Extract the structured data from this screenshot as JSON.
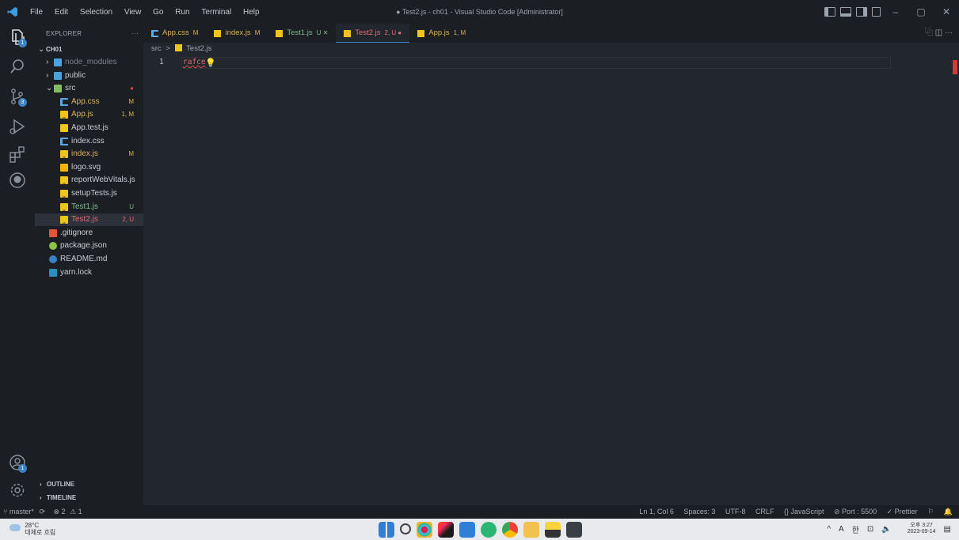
{
  "titlebar": {
    "menu": [
      "File",
      "Edit",
      "Selection",
      "View",
      "Go",
      "Run",
      "Terminal",
      "Help"
    ],
    "window_title": "● Test2.js - ch01 - Visual Studio Code [Administrator]",
    "minimize": "–",
    "restore": "▢",
    "close": "✕"
  },
  "activity": {
    "explorer_badge": "1",
    "scm_badge": "3",
    "accounts_badge": "1"
  },
  "sidebar": {
    "header": "EXPLORER",
    "more": "···",
    "root": "CH01",
    "items": [
      {
        "name": "node_modules",
        "twistie": "›",
        "indent": 1,
        "type": "folder",
        "status": ""
      },
      {
        "name": "public",
        "twistie": "›",
        "indent": 1,
        "type": "folder",
        "status": ""
      },
      {
        "name": "src",
        "twistie": "⌄",
        "indent": 1,
        "type": "folder-open",
        "status": "●"
      },
      {
        "name": "App.css",
        "indent": 2,
        "type": "css",
        "status": "M"
      },
      {
        "name": "App.js",
        "indent": 2,
        "type": "js",
        "status": "1, M"
      },
      {
        "name": "App.test.js",
        "indent": 2,
        "type": "test",
        "status": ""
      },
      {
        "name": "index.css",
        "indent": 2,
        "type": "css",
        "status": ""
      },
      {
        "name": "index.js",
        "indent": 2,
        "type": "js",
        "status": "M"
      },
      {
        "name": "logo.svg",
        "indent": 2,
        "type": "svg",
        "status": ""
      },
      {
        "name": "reportWebVitals.js",
        "indent": 2,
        "type": "js",
        "status": ""
      },
      {
        "name": "setupTests.js",
        "indent": 2,
        "type": "js",
        "status": ""
      },
      {
        "name": "Test1.js",
        "indent": 2,
        "type": "js",
        "status": "U"
      },
      {
        "name": "Test2.js",
        "indent": 2,
        "type": "js",
        "status": "2, U"
      },
      {
        "name": ".gitignore",
        "indent": 1,
        "type": "git",
        "status": ""
      },
      {
        "name": "package.json",
        "indent": 1,
        "type": "json",
        "status": ""
      },
      {
        "name": "README.md",
        "indent": 1,
        "type": "info",
        "status": ""
      },
      {
        "name": "yarn.lock",
        "indent": 1,
        "type": "yarn",
        "status": ""
      }
    ],
    "outline": "OUTLINE",
    "timeline": "TIMELINE"
  },
  "tabs": [
    {
      "name": "App.css",
      "mark": "M",
      "icon": "css"
    },
    {
      "name": "index.js",
      "mark": "M",
      "icon": "js"
    },
    {
      "name": "Test1.js",
      "mark": "U ✕",
      "icon": "js"
    },
    {
      "name": "Test2.js",
      "mark": "2, U ●",
      "icon": "js"
    },
    {
      "name": "App.js",
      "mark": "1, M",
      "icon": "js"
    }
  ],
  "tabs_right": "⿻  ◫  ···",
  "breadcrumb": {
    "folder": "src",
    "sep": ">",
    "file": "Test2.js"
  },
  "editor": {
    "line_number": "1",
    "code": "rafce",
    "bulb": "💡"
  },
  "status": {
    "branch": "master*",
    "sync": "⟳",
    "errors": "⊗ 2",
    "warnings": "⚠ 1",
    "position": "Ln 1, Col 6",
    "spaces": "Spaces: 3",
    "encoding": "UTF-8",
    "eol": "CRLF",
    "language": "{} JavaScript",
    "port": "⊘ Port : 5500",
    "prettier": "✓ Prettier"
  },
  "taskbar": {
    "temp": "28°C",
    "weather": "대체로 흐림",
    "ime1": "^",
    "ime2": "A",
    "ime3": "한",
    "time": "오후 3:27",
    "date": "2023-09-14"
  },
  "colors": {
    "js": "#f0c419",
    "css": "#5aa9e6",
    "accent": "#3b82c4",
    "modified": "#d9b15d",
    "untracked": "#81b88b",
    "error": "#e06c75"
  }
}
